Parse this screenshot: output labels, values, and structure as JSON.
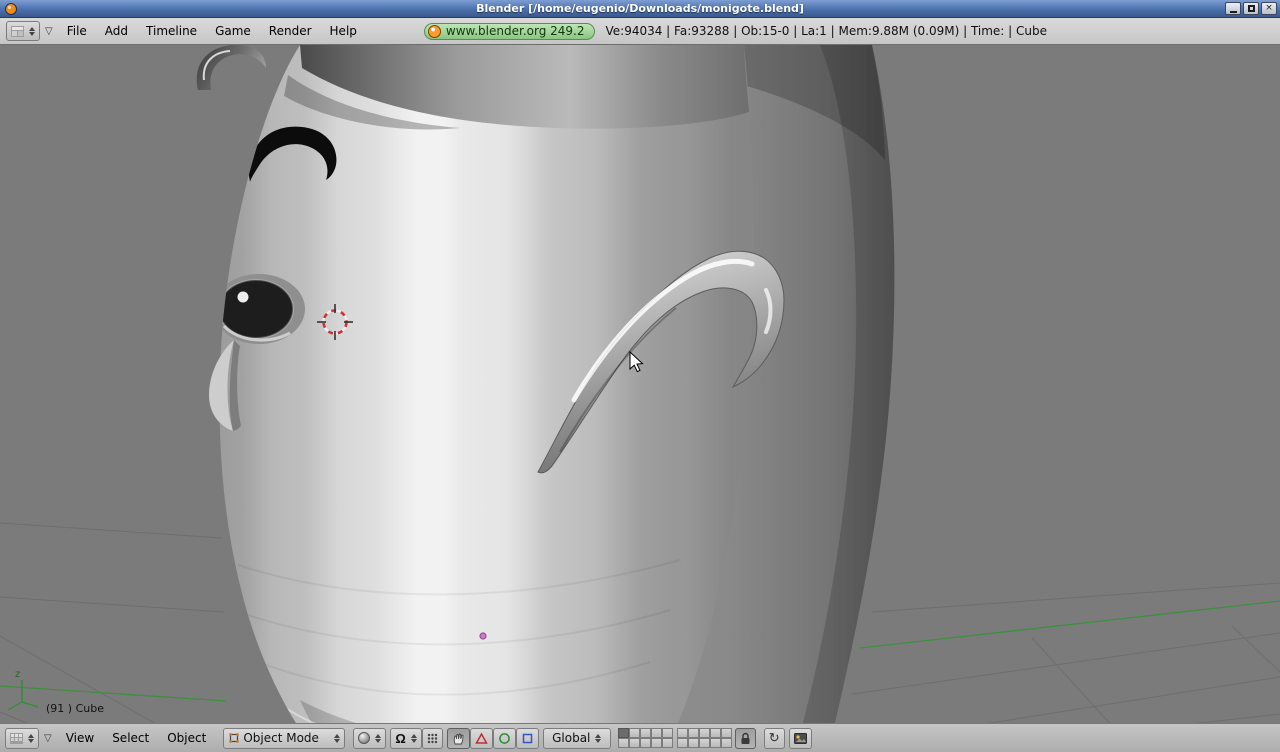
{
  "window": {
    "title": "Blender [/home/eugenio/Downloads/monigote.blend]"
  },
  "icons": {
    "close": "×",
    "collapse": "▽",
    "pivot_omega": "Ω",
    "refresh": "↻"
  },
  "top_header": {
    "menus": [
      "File",
      "Add",
      "Timeline",
      "Game",
      "Render",
      "Help"
    ],
    "version_badge": "www.blender.org 249.2",
    "stats": "Ve:94034 | Fa:93288 | Ob:15-0 | La:1 | Mem:9.88M (0.09M) | Time: | Cube"
  },
  "viewport": {
    "object_info_label": "(91 ) Cube",
    "axis_label": "z",
    "colors": {
      "background": "#7b7b7b",
      "grid_line": "#6e6e6e",
      "axis_y_green": "#3f8f3f",
      "cursor_3d_red": "#cc3333",
      "object_center_pink": "#cf7ccf"
    }
  },
  "bottom_header": {
    "menus": [
      "View",
      "Select",
      "Object"
    ],
    "mode_select": "Object Mode",
    "orientation_select": "Global",
    "layers": {
      "groups": 2,
      "rows": 2,
      "cols": 5,
      "active_layer": 1
    },
    "manipulator_colors": {
      "translate": "#c03030",
      "rotate": "#2e8b2e",
      "scale": "#3355cc"
    }
  }
}
